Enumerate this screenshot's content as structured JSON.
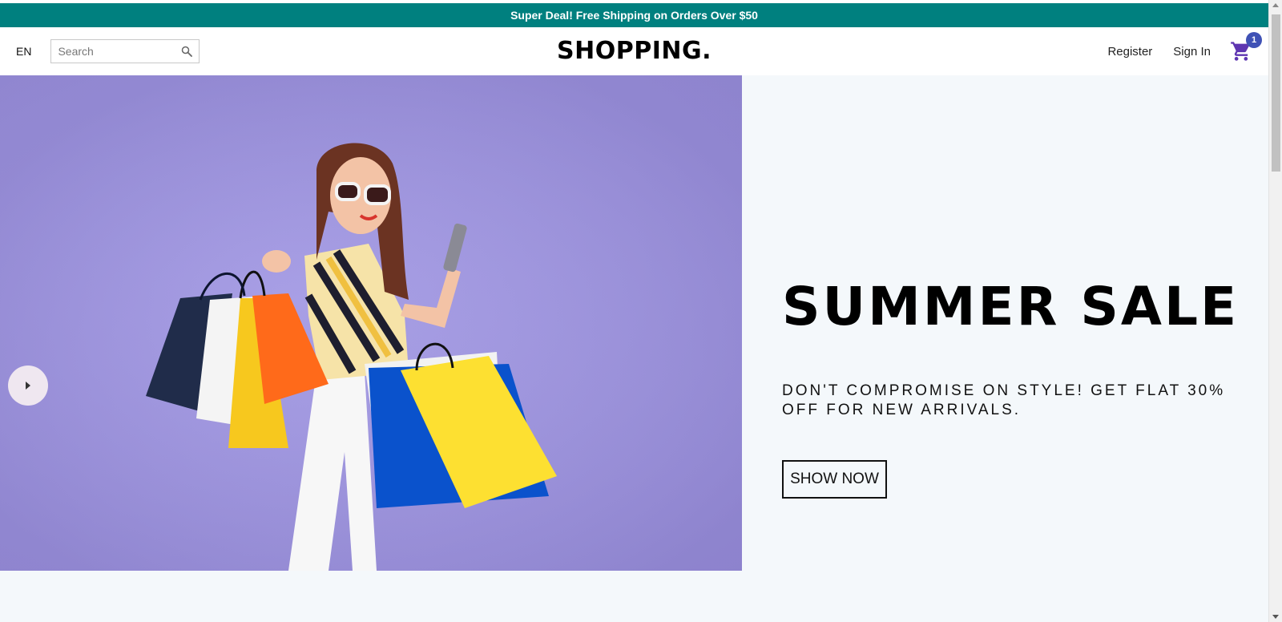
{
  "announcement": {
    "text": "Super Deal! Free Shipping on Orders Over $50"
  },
  "header": {
    "language": "EN",
    "search": {
      "placeholder": "Search",
      "value": ""
    },
    "logo": "SHOPPING.",
    "register_label": "Register",
    "signin_label": "Sign In",
    "cart_count": "1"
  },
  "hero": {
    "title": "SUMMER SALE",
    "description": "DON'T COMPROMISE ON STYLE! GET FLAT 30% OFF FOR NEW ARRIVALS.",
    "button_label": "SHOW NOW",
    "image_icon": "woman-with-shopping-bags-photo",
    "arrow_icon": "arrow-right-icon"
  },
  "colors": {
    "announcement_bg": "#00807f",
    "hero_bg": "#f4f8fb",
    "image_bg": "#a198df",
    "cart_icon": "#5e35b1",
    "badge": "#3f51b5"
  }
}
